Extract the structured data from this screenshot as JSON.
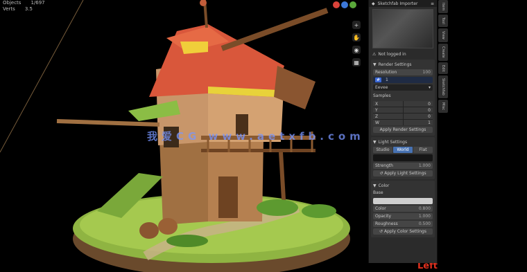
{
  "viewport": {
    "stats": [
      {
        "label": "Objects",
        "value": "1/697"
      },
      {
        "label": "Verts",
        "value": "3.5"
      }
    ],
    "gizmo_colors": [
      "#d9433a",
      "#3c78d8",
      "#5aa83a"
    ],
    "watermark": "我爱CG www.aetxfb.com",
    "corner_mark": "Left"
  },
  "panel": {
    "header_title": "Sketchfab Importer",
    "status_text": "Not logged in",
    "render_settings": {
      "title": "Render Settings",
      "resolution_label": "Resolution",
      "resolution_value": "100",
      "frame_field_value": "1",
      "engine_select": "Eevee",
      "samples_label": "Samples",
      "grid": [
        "X",
        "0",
        "Y",
        "0",
        "Z",
        "0",
        "W",
        "1"
      ],
      "apply_button": "Apply Render Settings"
    },
    "light_settings": {
      "title": "Light Settings",
      "modes": [
        "Studio",
        "World",
        "Flat"
      ],
      "active_mode": "World",
      "strength_label": "Strength",
      "strength_value": "1.000",
      "apply_button": "Apply Light Settings"
    },
    "color": {
      "title": "Color",
      "label": "Base",
      "rows": [
        {
          "label": "Color",
          "value": "0.800"
        },
        {
          "label": "Opacity",
          "value": "1.000"
        },
        {
          "label": "Roughness",
          "value": "0.500"
        }
      ],
      "apply_button": "Apply Color Settings"
    }
  },
  "vtabs": [
    "Item",
    "Tool",
    "View",
    "Create",
    "Edit",
    "Sketchfab",
    "Misc"
  ]
}
